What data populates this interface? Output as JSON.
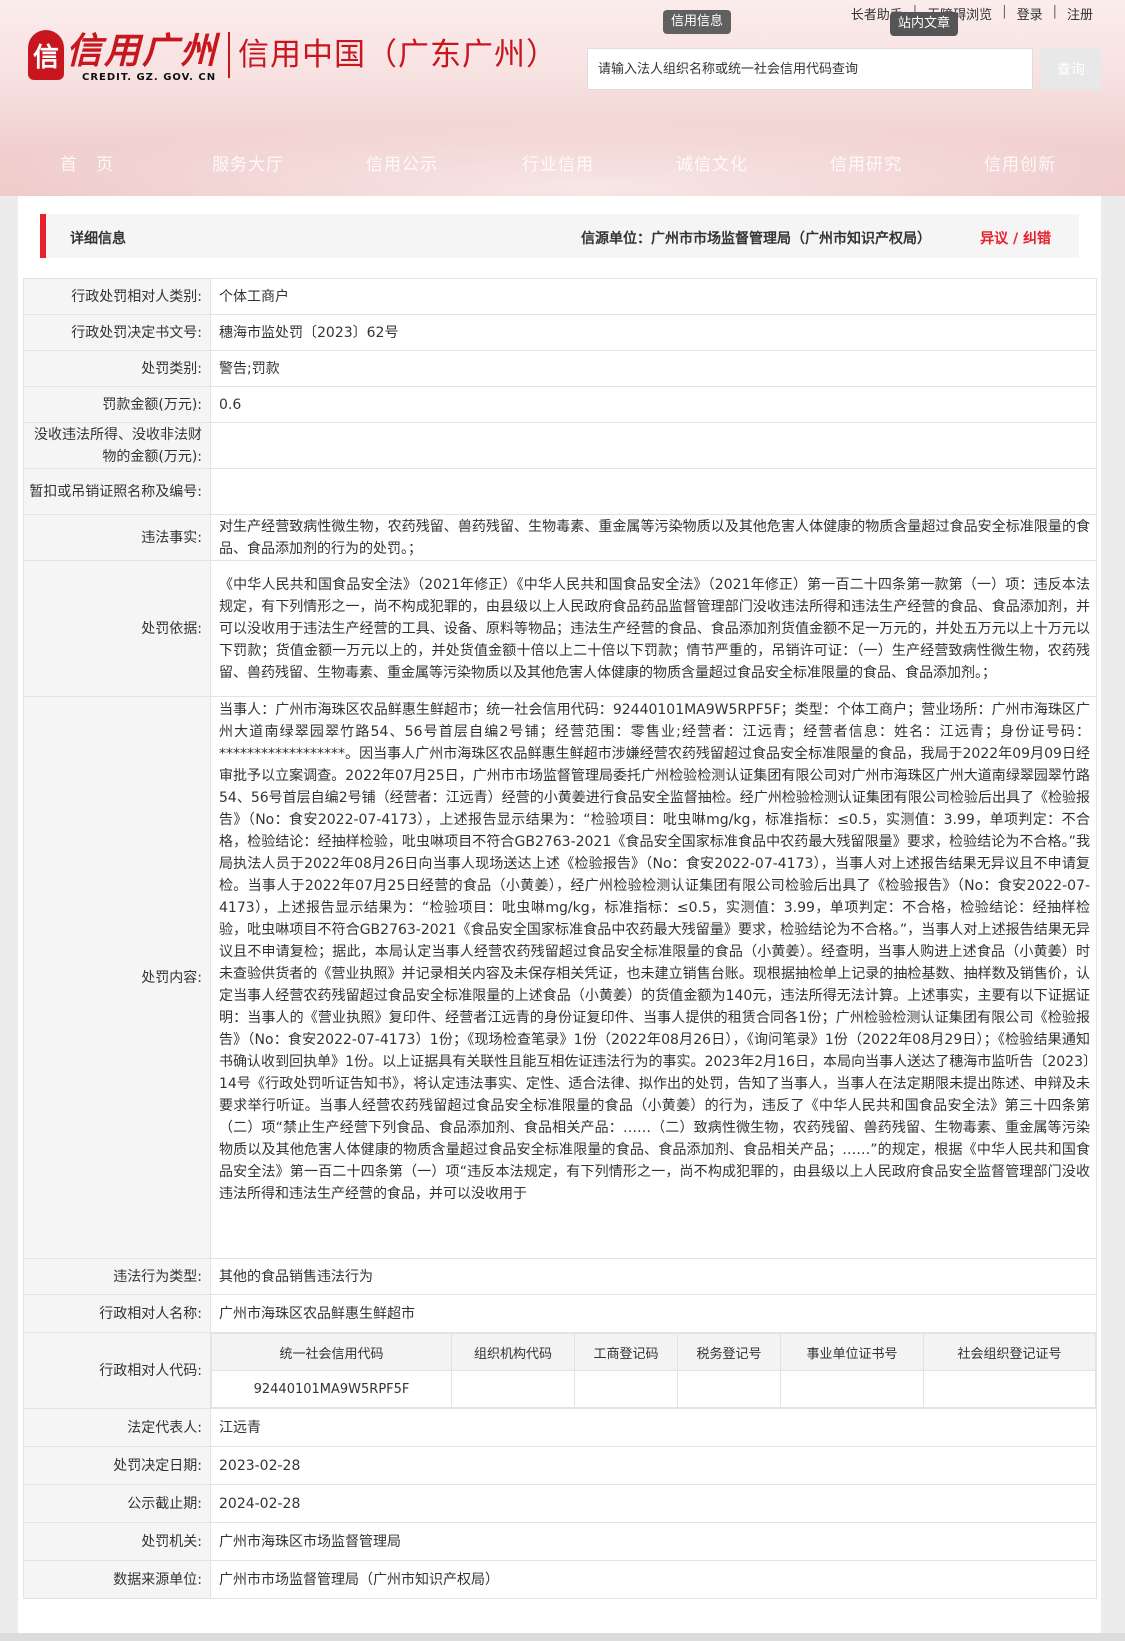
{
  "header": {
    "logo_mark": "信",
    "logo_cn": "信用广州",
    "logo_en": "CREDIT. GZ. GOV. CN",
    "logo_sub": "信用中国（广东广州）",
    "top_links": [
      "长者助手",
      "无障碍浏览",
      "登录",
      "注册"
    ],
    "badge_credit": "信用信息",
    "badge_site": "站内文章",
    "search_placeholder": "请输入法人组织名称或统一社会信用代码查询",
    "search_button": "查询",
    "nav": [
      "首　页",
      "服务大厅",
      "信用公示",
      "行业信用",
      "诚信文化",
      "信用研究",
      "信用创新"
    ]
  },
  "titlebar": {
    "title": "详细信息",
    "source": "信源单位：广州市市场监督管理局（广州市知识产权局）",
    "objection": "异议 / 纠错"
  },
  "rows": {
    "r1": {
      "k": "行政处罚相对人类别:",
      "v": "个体工商户"
    },
    "r2": {
      "k": "行政处罚决定书文号:",
      "v": "穗海市监处罚〔2023〕62号"
    },
    "r3": {
      "k": "处罚类别:",
      "v": "警告;罚款"
    },
    "r4": {
      "k": "罚款金额(万元):",
      "v": "0.6"
    },
    "r5": {
      "k": "没收违法所得、没收非法财物的金额(万元):",
      "v": ""
    },
    "r6": {
      "k": "暂扣或吊销证照名称及编号:",
      "v": ""
    },
    "r7": {
      "k": "违法事实:",
      "v": "对生产经营致病性微生物，农药残留、兽药残留、生物毒素、重金属等污染物质以及其他危害人体健康的物质含量超过食品安全标准限量的食品、食品添加剂的行为的处罚。；"
    },
    "r8": {
      "k": "处罚依据:",
      "v": "《中华人民共和国食品安全法》（2021年修正）《中华人民共和国食品安全法》（2021年修正）第一百二十四条第一款第（一）项：违反本法规定，有下列情形之一，尚不构成犯罪的，由县级以上人民政府食品药品监督管理部门没收违法所得和违法生产经营的食品、食品添加剂，并可以没收用于违法生产经营的工具、设备、原料等物品；违法生产经营的食品、食品添加剂货值金额不足一万元的，并处五万元以上十万元以下罚款；货值金额一万元以上的，并处货值金额十倍以上二十倍以下罚款；情节严重的，吊销许可证：（一）生产经营致病性微生物，农药残留、兽药残留、生物毒素、重金属等污染物质以及其他危害人体健康的物质含量超过食品安全标准限量的食品、食品添加剂。；"
    },
    "r9": {
      "k": "处罚内容:",
      "v": "当事人：广州市海珠区农品鲜惠生鲜超市；统一社会信用代码：92440101MA9W5RPF5F；类型：个体工商户；营业场所：广州市海珠区广州大道南绿翠园翠竹路54、56号首层自编2号铺；经营范围：零售业;经营者：江远青；经营者信息：姓名：江远青；身份证号码：******************。因当事人广州市海珠区农品鲜惠生鲜超市涉嫌经营农药残留超过食品安全标准限量的食品，我局于2022年09月09日经审批予以立案调查。2022年07月25日，广州市市场监督管理局委托广州检验检测认证集团有限公司对广州市海珠区广州大道南绿翠园翠竹路54、56号首层自编2号铺（经营者：江远青）经营的小黄姜进行食品安全监督抽检。经广州检验检测认证集团有限公司检验后出具了《检验报告》（No：食安2022-07-4173），上述报告显示结果为：“检验项目：吡虫啉mg/kg，标准指标：≤0.5，实测值：3.99，单项判定：不合格，检验结论：经抽样检验，吡虫啉项目不符合GB2763-2021《食品安全国家标准食品中农药最大残留限量》要求，检验结论为不合格。”我局执法人员于2022年08月26日向当事人现场送达上述《检验报告》（No：食安2022-07-4173），当事人对上述报告结果无异议且不申请复检。当事人于2022年07月25日经营的食品（小黄姜），经广州检验检测认证集团有限公司检验后出具了《检验报告》（No：食安2022-07-4173），上述报告显示结果为：“检验项目：吡虫啉mg/kg，标准指标：≤0.5，实测值：3.99，单项判定：不合格，检验结论：经抽样检验，吡虫啉项目不符合GB2763-2021《食品安全国家标准食品中农药最大残留量》要求，检验结论为不合格。”，当事人对上述报告结果无异议且不申请复检；据此，本局认定当事人经营农药残留超过食品安全标准限量的食品（小黄姜）。经查明，当事人购进上述食品（小黄姜）时未查验供货者的《营业执照》并记录相关内容及未保存相关凭证，也未建立销售台账。现根据抽检单上记录的抽检基数、抽样数及销售价，认定当事人经营农药残留超过食品安全标准限量的上述食品（小黄姜）的货值金额为140元，违法所得无法计算。上述事实，主要有以下证据证明：当事人的《营业执照》复印件、经营者江远青的身份证复印件、当事人提供的租赁合同各1份；广州检验检测认证集团有限公司《检验报告》（No：食安2022-07-4173）1份；《现场检查笔录》1份（2022年08月26日），《询问笔录》1份（2022年08月29日）；《检验结果通知书确认收到回执单》1份。以上证据具有关联性且能互相佐证违法行为的事实。2023年2月16日，本局向当事人送达了穗海市监听告〔2023〕14号《行政处罚听证告知书》，将认定违法事实、定性、适合法律、拟作出的处罚，告知了当事人，当事人在法定期限未提出陈述、申辩及未要求举行听证。当事人经营农药残留超过食品安全标准限量的食品（小黄姜）的行为，违反了《中华人民共和国食品安全法》第三十四条第（二）项“禁止生产经营下列食品、食品添加剂、食品相关产品：……（二）致病性微生物，农药残留、兽药残留、生物毒素、重金属等污染物质以及其他危害人体健康的物质含量超过食品安全标准限量的食品、食品添加剂、食品相关产品；……”的规定，根据《中华人民共和国食品安全法》第一百二十四条第（一）项“违反本法规定，有下列情形之一，尚不构成犯罪的，由县级以上人民政府食品安全监督管理部门没收违法所得和违法生产经营的食品，并可以没收用于"
    },
    "r10": {
      "k": "违法行为类型:",
      "v": "其他的食品销售违法行为"
    },
    "r11": {
      "k": "行政相对人名称:",
      "v": "广州市海珠区农品鲜惠生鲜超市"
    },
    "r12": {
      "k": "行政相对人代码:"
    },
    "r13": {
      "k": "法定代表人:",
      "v": "江远青"
    },
    "r14": {
      "k": "处罚决定日期:",
      "v": "2023-02-28"
    },
    "r15": {
      "k": "公示截止期:",
      "v": "2024-02-28"
    },
    "r16": {
      "k": "处罚机关:",
      "v": "广州市海珠区市场监督管理局"
    },
    "r17": {
      "k": "数据来源单位:",
      "v": "广州市市场监督管理局（广州市知识产权局）"
    }
  },
  "codes": {
    "headers": [
      "统一社会信用代码",
      "组织机构代码",
      "工商登记码",
      "税务登记号",
      "事业单位证书号",
      "社会组织登记证号"
    ],
    "values": [
      "92440101MA9W5RPF5F",
      "",
      "",
      "",
      "",
      ""
    ]
  }
}
